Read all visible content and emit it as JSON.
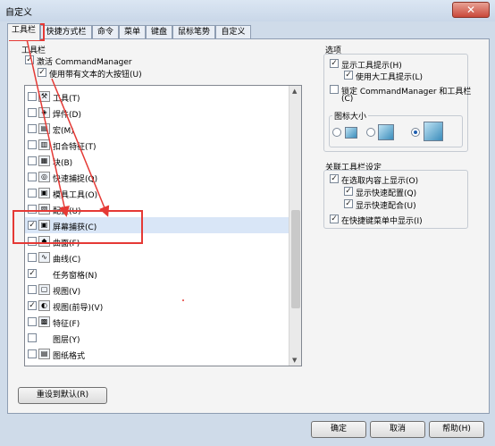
{
  "window": {
    "title": "自定义",
    "close_glyph": "✕"
  },
  "tabs": [
    "工具栏",
    "快捷方式栏",
    "命令",
    "菜单",
    "键盘",
    "鼠标笔势",
    "自定义"
  ],
  "toolbars_section": {
    "label": "工具栏",
    "activate_cm": {
      "label": "激活 CommandManager",
      "checked": true
    },
    "large_buttons": {
      "label": "使用带有文本的大按钮(U)",
      "checked": true
    }
  },
  "toolbar_list": [
    {
      "label": "工具(T)",
      "checked": false,
      "icon": "tools-icon",
      "glyph": "⚒"
    },
    {
      "label": "焊件(D)",
      "checked": false,
      "icon": "weldments-icon",
      "glyph": "◈"
    },
    {
      "label": "宏(M)",
      "checked": false,
      "icon": "macro-icon",
      "glyph": "▤"
    },
    {
      "label": "扣合特征(T)",
      "checked": false,
      "icon": "fastening-features-icon",
      "glyph": "▥"
    },
    {
      "label": "块(B)",
      "checked": false,
      "icon": "blocks-icon",
      "glyph": "▦"
    },
    {
      "label": "快速捕捉(Q)",
      "checked": false,
      "icon": "quick-snaps-icon",
      "glyph": "◎"
    },
    {
      "label": "模具工具(O)",
      "checked": false,
      "icon": "mold-tools-icon",
      "glyph": "▣"
    },
    {
      "label": "配置(U)",
      "checked": false,
      "icon": "configurations-icon",
      "glyph": "▧"
    },
    {
      "label": "屏幕捕获(C)",
      "checked": true,
      "icon": "screen-capture-icon",
      "glyph": "▣",
      "selected": true
    },
    {
      "label": "曲面(F)",
      "checked": false,
      "icon": "surfaces-icon",
      "glyph": "◆"
    },
    {
      "label": "曲线(C)",
      "checked": false,
      "icon": "curves-icon",
      "glyph": "∿"
    },
    {
      "label": "任务窗格(N)",
      "checked": true,
      "icon": "",
      "glyph": ""
    },
    {
      "label": "视图(V)",
      "checked": false,
      "icon": "view-icon",
      "glyph": "▢"
    },
    {
      "label": "视图(前导)(V)",
      "checked": true,
      "icon": "view-heads-up-icon",
      "glyph": "◐"
    },
    {
      "label": "特征(F)",
      "checked": false,
      "icon": "features-icon",
      "glyph": "▩"
    },
    {
      "label": "图层(Y)",
      "checked": false,
      "icon": "",
      "glyph": ""
    },
    {
      "label": "图纸格式",
      "checked": false,
      "icon": "sheet-format-icon",
      "glyph": "▤"
    }
  ],
  "reset_button": "重设到默认(R)",
  "options": {
    "label": "选项",
    "show_tooltips": {
      "label": "显示工具提示(H)",
      "checked": true
    },
    "large_tooltips": {
      "label": "使用大工具提示(L)",
      "checked": true
    },
    "lock_cm": {
      "label": "锁定 CommandManager 和工具栏",
      "checked": false
    },
    "lock_cm_key": "(C)",
    "icon_size": {
      "label": "图标大小",
      "selected": "large"
    }
  },
  "context_toolbar": {
    "label": "关联工具栏设定",
    "show_in_selection": {
      "label": "在选取内容上显示(O)",
      "checked": true
    },
    "show_quick_config": {
      "label": "显示快速配置(Q)",
      "checked": true
    },
    "show_quick_mates": {
      "label": "显示快速配合(U)",
      "checked": true
    },
    "show_in_shortcut": {
      "label": "在快捷键菜单中显示(I)",
      "checked": true
    }
  },
  "buttons": {
    "ok": "确定",
    "cancel": "取消",
    "help": "帮助(H)"
  },
  "annotation_color": "#e53935"
}
